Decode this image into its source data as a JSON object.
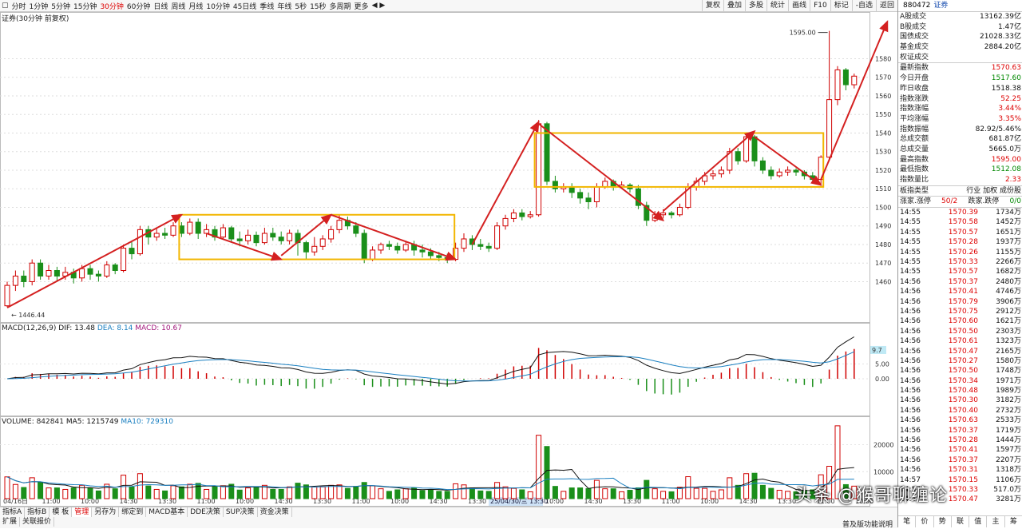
{
  "toolbar": {
    "periods": [
      "分时",
      "1分钟",
      "5分钟",
      "15分钟",
      "30分钟",
      "60分钟",
      "日线",
      "周线",
      "月线",
      "10分钟",
      "45日线",
      "季线",
      "年线",
      "5秒",
      "15秒",
      "多周期",
      "更多"
    ],
    "active_index": 4,
    "right_buttons": [
      "复权",
      "叠加",
      "多股",
      "统计",
      "画线",
      "F10",
      "标记",
      "-自选",
      "返回"
    ]
  },
  "symbol_line": "证券(30分钟 前复权)",
  "price_axis": {
    "ticks": [
      1460,
      1470,
      1480,
      1490,
      1500,
      1510,
      1520,
      1530,
      1540,
      1550,
      1560,
      1570,
      1580
    ]
  },
  "annotations": {
    "high": "1595.00",
    "low": "1446.44"
  },
  "macd": {
    "label": "MACD(12,26,9)",
    "dif": "DIF: 13.48",
    "dea": "DEA: 8.14",
    "macd": "MACD: 10.67",
    "ticks": [
      "5.00",
      "0.00"
    ],
    "badge": "9.7"
  },
  "volume": {
    "label": "VOLUME: 842841",
    "ma5": "MA5: 1215749",
    "ma10": "MA10: 729310",
    "ticks": [
      "20000",
      "10000"
    ]
  },
  "time_axis": [
    "04/16日",
    "11:00",
    "10:00",
    "14:30",
    "13:30",
    "11:00",
    "10:00",
    "14:30",
    "13:30",
    "11:00",
    "10:00",
    "14:30",
    "13:30",
    "11:00",
    "10:00",
    "14:30",
    "13:30",
    "11:00",
    "10:00",
    "14:30",
    "13:30",
    "11:00",
    "10:00"
  ],
  "time_axis_highlight": "25/04/30/三 13:30",
  "panel": {
    "code": "880472",
    "name": "证券",
    "stats": [
      {
        "label": "A股成交",
        "value": "13162.39亿",
        "cls": "blk"
      },
      {
        "label": "B股成交",
        "value": "1.47亿",
        "cls": "blk"
      },
      {
        "label": "国债成交",
        "value": "21028.33亿",
        "cls": "blk"
      },
      {
        "label": "基金成交",
        "value": "2884.20亿",
        "cls": "blk"
      },
      {
        "label": "权证成交",
        "value": "",
        "cls": "blk"
      }
    ],
    "quotes": [
      {
        "label": "最新指数",
        "value": "1570.63",
        "cls": "red"
      },
      {
        "label": "今日开盘",
        "value": "1517.60",
        "cls": "grn"
      },
      {
        "label": "昨日收盘",
        "value": "1518.38",
        "cls": "blk"
      },
      {
        "label": "指数涨跌",
        "value": "52.25",
        "cls": "red"
      },
      {
        "label": "指数涨幅",
        "value": "3.44%",
        "cls": "red"
      },
      {
        "label": "平均涨幅",
        "value": "3.35%",
        "cls": "red"
      },
      {
        "label": "指数振幅",
        "value": "82.92/5.46%",
        "cls": "blk"
      },
      {
        "label": "总成交额",
        "value": "681.87亿",
        "cls": "blk"
      },
      {
        "label": "总成交量",
        "value": "5665.0万",
        "cls": "blk"
      },
      {
        "label": "最高指数",
        "value": "1595.00",
        "cls": "red"
      },
      {
        "label": "最低指数",
        "value": "1512.08",
        "cls": "grn"
      },
      {
        "label": "指数量比",
        "value": "2.33",
        "cls": "red"
      }
    ],
    "type_row": {
      "label": "板指类型",
      "value": "行业 加权 成份股"
    },
    "breadth_row": {
      "label": "涨家.涨停",
      "v1": "50/2",
      "label2": "跌家.跌停",
      "v2": "0/0"
    },
    "ticks": [
      {
        "t": "14:55",
        "p": "1570.39",
        "v": "1734万"
      },
      {
        "t": "14:55",
        "p": "1570.58",
        "v": "1452万"
      },
      {
        "t": "14:55",
        "p": "1570.57",
        "v": "1651万"
      },
      {
        "t": "14:55",
        "p": "1570.28",
        "v": "1937万"
      },
      {
        "t": "14:55",
        "p": "1570.26",
        "v": "1155万"
      },
      {
        "t": "14:55",
        "p": "1570.33",
        "v": "2266万"
      },
      {
        "t": "14:55",
        "p": "1570.57",
        "v": "1682万"
      },
      {
        "t": "14:56",
        "p": "1570.37",
        "v": "2480万"
      },
      {
        "t": "14:56",
        "p": "1570.41",
        "v": "4746万"
      },
      {
        "t": "14:56",
        "p": "1570.79",
        "v": "3906万"
      },
      {
        "t": "14:56",
        "p": "1570.75",
        "v": "2912万"
      },
      {
        "t": "14:56",
        "p": "1570.60",
        "v": "1621万"
      },
      {
        "t": "14:56",
        "p": "1570.50",
        "v": "2303万"
      },
      {
        "t": "14:56",
        "p": "1570.61",
        "v": "1323万"
      },
      {
        "t": "14:56",
        "p": "1570.47",
        "v": "2165万"
      },
      {
        "t": "14:56",
        "p": "1570.27",
        "v": "1580万"
      },
      {
        "t": "14:56",
        "p": "1570.50",
        "v": "1748万"
      },
      {
        "t": "14:56",
        "p": "1570.34",
        "v": "1971万"
      },
      {
        "t": "14:56",
        "p": "1570.48",
        "v": "1989万"
      },
      {
        "t": "14:56",
        "p": "1570.30",
        "v": "3182万"
      },
      {
        "t": "14:56",
        "p": "1570.40",
        "v": "2732万"
      },
      {
        "t": "14:56",
        "p": "1570.63",
        "v": "2533万"
      },
      {
        "t": "14:56",
        "p": "1570.37",
        "v": "1719万"
      },
      {
        "t": "14:56",
        "p": "1570.28",
        "v": "1444万"
      },
      {
        "t": "14:56",
        "p": "1570.41",
        "v": "1597万"
      },
      {
        "t": "14:56",
        "p": "1570.37",
        "v": "2207万"
      },
      {
        "t": "14:56",
        "p": "1570.31",
        "v": "1318万"
      },
      {
        "t": "14:57",
        "p": "1570.15",
        "v": "1106万"
      },
      {
        "t": "14:57",
        "p": "1570.33",
        "v": "517.0万"
      },
      {
        "t": "14:57",
        "p": "1570.47",
        "v": "3281万"
      }
    ],
    "footer": [
      "笔",
      "价",
      "势",
      "联",
      "值",
      "主",
      "筹"
    ]
  },
  "bottombar": {
    "tabs": [
      "指标A",
      "指标B",
      "模 板",
      "管理",
      "另存为",
      "绑定到",
      "MACD基本",
      "DDE决策",
      "SUP决策",
      "资金决策"
    ],
    "active_index": 3,
    "tabs2": [
      "扩展",
      "关联报价"
    ],
    "help": "普及版功能说明"
  },
  "watermark": "头条 @猴哥聊缠论",
  "colors": {
    "up": "#d00000",
    "down": "#1a8f1a",
    "box": "#f2b600",
    "arrow": "#d42020",
    "ma1": "#111111",
    "ma2": "#1a7fc0"
  },
  "candles": [
    [
      1447,
      1458,
      1446.44,
      1460
    ],
    [
      1458,
      1463,
      1455,
      1466
    ],
    [
      1463,
      1460,
      1457,
      1466
    ],
    [
      1460,
      1470,
      1458,
      1472
    ],
    [
      1470,
      1463,
      1461,
      1472
    ],
    [
      1463,
      1466,
      1461,
      1469
    ],
    [
      1466,
      1463,
      1460,
      1468
    ],
    [
      1463,
      1465,
      1461,
      1468
    ],
    [
      1465,
      1462,
      1459,
      1467
    ],
    [
      1462,
      1467,
      1460,
      1469
    ],
    [
      1467,
      1464,
      1461,
      1469
    ],
    [
      1464,
      1463,
      1460,
      1466
    ],
    [
      1463,
      1469,
      1462,
      1471
    ],
    [
      1469,
      1466,
      1464,
      1470
    ],
    [
      1466,
      1478,
      1465,
      1480
    ],
    [
      1478,
      1475,
      1472,
      1482
    ],
    [
      1475,
      1488,
      1474,
      1490
    ],
    [
      1488,
      1484,
      1480,
      1490
    ],
    [
      1484,
      1486,
      1482,
      1489
    ],
    [
      1486,
      1485,
      1483,
      1489
    ],
    [
      1485,
      1490,
      1484,
      1492
    ],
    [
      1490,
      1486,
      1484,
      1492
    ],
    [
      1486,
      1492,
      1485,
      1494
    ],
    [
      1492,
      1486,
      1483,
      1494
    ],
    [
      1486,
      1488,
      1484,
      1491
    ],
    [
      1488,
      1484,
      1482,
      1490
    ],
    [
      1484,
      1489,
      1483,
      1491
    ],
    [
      1489,
      1483,
      1481,
      1490
    ],
    [
      1483,
      1482,
      1479,
      1487
    ],
    [
      1482,
      1485,
      1480,
      1488
    ],
    [
      1485,
      1481,
      1479,
      1487
    ],
    [
      1481,
      1486,
      1480,
      1489
    ],
    [
      1486,
      1484,
      1482,
      1489
    ],
    [
      1484,
      1482,
      1480,
      1487
    ],
    [
      1482,
      1486,
      1480,
      1488
    ],
    [
      1486,
      1481,
      1474,
      1488
    ],
    [
      1481,
      1476,
      1472,
      1482
    ],
    [
      1476,
      1479,
      1474,
      1484
    ],
    [
      1479,
      1483,
      1477,
      1485
    ],
    [
      1483,
      1488,
      1481,
      1490
    ],
    [
      1488,
      1493,
      1486,
      1496
    ],
    [
      1493,
      1490,
      1488,
      1495
    ],
    [
      1490,
      1486,
      1484,
      1492
    ],
    [
      1486,
      1472,
      1470,
      1488
    ],
    [
      1472,
      1477,
      1471,
      1479
    ],
    [
      1477,
      1480,
      1475,
      1481
    ],
    [
      1480,
      1479,
      1477,
      1482
    ],
    [
      1479,
      1477,
      1475,
      1481
    ],
    [
      1477,
      1480,
      1476,
      1482
    ],
    [
      1480,
      1477,
      1474,
      1482
    ],
    [
      1477,
      1476,
      1473,
      1480
    ],
    [
      1476,
      1474,
      1472,
      1478
    ],
    [
      1474,
      1473,
      1471,
      1476
    ],
    [
      1473,
      1472,
      1470,
      1475
    ],
    [
      1472,
      1478,
      1471,
      1481
    ],
    [
      1478,
      1483,
      1476,
      1486
    ],
    [
      1483,
      1480,
      1477,
      1485
    ],
    [
      1480,
      1479,
      1477,
      1483
    ],
    [
      1479,
      1478,
      1476,
      1481
    ],
    [
      1478,
      1490,
      1477,
      1492
    ],
    [
      1490,
      1494,
      1488,
      1496
    ],
    [
      1494,
      1497,
      1492,
      1499
    ],
    [
      1497,
      1495,
      1493,
      1499
    ],
    [
      1495,
      1496,
      1494,
      1498
    ],
    [
      1496,
      1545,
      1495,
      1547
    ],
    [
      1545,
      1514,
      1512,
      1546
    ],
    [
      1514,
      1510,
      1508,
      1517
    ],
    [
      1510,
      1511,
      1508,
      1513
    ],
    [
      1511,
      1508,
      1505,
      1513
    ],
    [
      1508,
      1505,
      1502,
      1510
    ],
    [
      1505,
      1503,
      1499,
      1508
    ],
    [
      1503,
      1511,
      1500,
      1513
    ],
    [
      1511,
      1514,
      1510,
      1516
    ],
    [
      1514,
      1511,
      1509,
      1515
    ],
    [
      1511,
      1512,
      1510,
      1514
    ],
    [
      1512,
      1510,
      1508,
      1513
    ],
    [
      1510,
      1501,
      1499,
      1512
    ],
    [
      1501,
      1493,
      1490,
      1503
    ],
    [
      1493,
      1496,
      1492,
      1498
    ],
    [
      1496,
      1497,
      1494,
      1499
    ],
    [
      1497,
      1496,
      1494,
      1498
    ],
    [
      1496,
      1500,
      1495,
      1502
    ],
    [
      1500,
      1511,
      1499,
      1513
    ],
    [
      1511,
      1514,
      1509,
      1516
    ],
    [
      1514,
      1517,
      1512,
      1519
    ],
    [
      1517,
      1518,
      1515,
      1520
    ],
    [
      1518,
      1520,
      1516,
      1522
    ],
    [
      1520,
      1530,
      1518,
      1532
    ],
    [
      1530,
      1525,
      1523,
      1532
    ],
    [
      1525,
      1538,
      1524,
      1540
    ],
    [
      1538,
      1525,
      1522,
      1539
    ],
    [
      1525,
      1520,
      1518,
      1527
    ],
    [
      1520,
      1517,
      1515,
      1522
    ],
    [
      1517,
      1519,
      1516,
      1521
    ],
    [
      1519,
      1520,
      1517,
      1522
    ],
    [
      1520,
      1519,
      1517,
      1521
    ],
    [
      1519,
      1517,
      1515,
      1520
    ],
    [
      1517,
      1515,
      1513,
      1519
    ],
    [
      1515,
      1527,
      1512.08,
      1528
    ],
    [
      1527,
      1558,
      1525,
      1595
    ],
    [
      1558,
      1574,
      1555,
      1576
    ],
    [
      1574,
      1566,
      1563,
      1575
    ],
    [
      1566,
      1570.63,
      1564,
      1572
    ]
  ]
}
